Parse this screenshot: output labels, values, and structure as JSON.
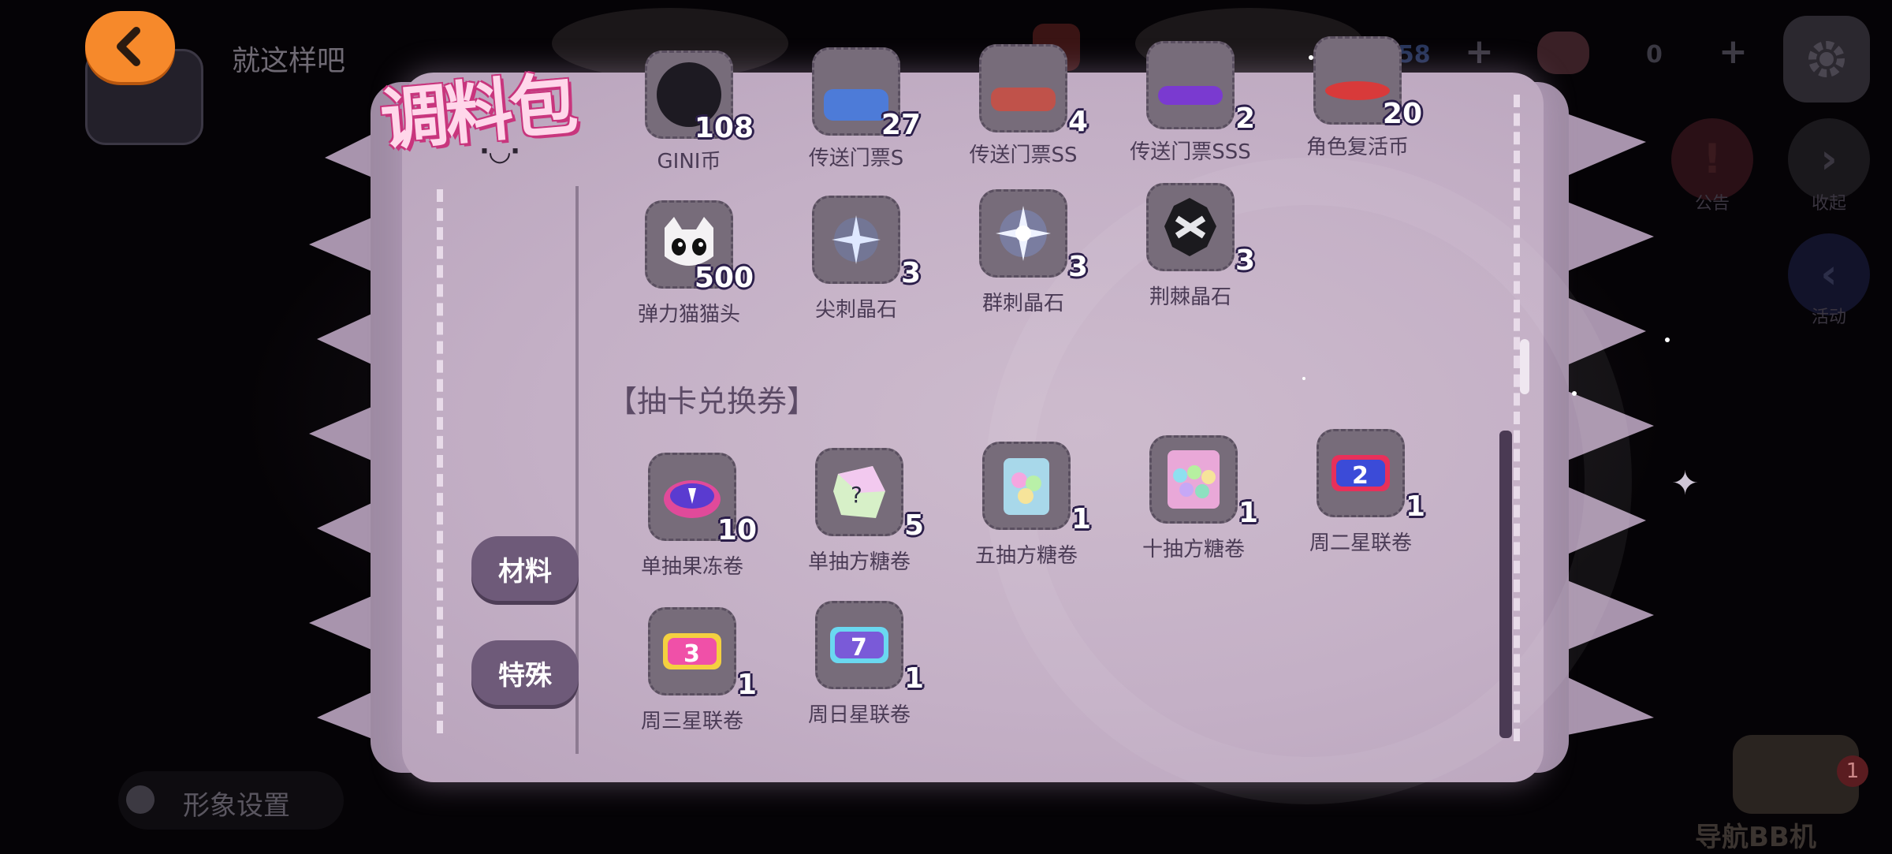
{
  "header": {
    "player_name": "就这样吧",
    "currency_1": "758",
    "currency_2": "0"
  },
  "side_buttons": {
    "notice": "公告",
    "collapse": "收起",
    "activity": "活动"
  },
  "bottom": {
    "profile_settings": "形象设置",
    "nav_bb": "导航BB机",
    "nav_badge": "1"
  },
  "panel": {
    "title": "调料包",
    "face": "·◡·",
    "tabs": {
      "material": "材料",
      "special": "特殊"
    },
    "section_gacha": "【抽卡兑换券】"
  },
  "items_row1": [
    {
      "name": "GINI币",
      "qty": "108",
      "icon": "gini-coin-icon"
    },
    {
      "name": "传送门票S",
      "qty": "27",
      "icon": "portal-ticket-s-icon"
    },
    {
      "name": "传送门票SS",
      "qty": "4",
      "icon": "portal-ticket-ss-icon"
    },
    {
      "name": "传送门票SSS",
      "qty": "2",
      "icon": "portal-ticket-sss-icon"
    },
    {
      "name": "角色复活币",
      "qty": "20",
      "icon": "revive-coin-icon"
    }
  ],
  "items_row2": [
    {
      "name": "弹力猫猫头",
      "qty": "500",
      "icon": "cat-head-icon"
    },
    {
      "name": "尖刺晶石",
      "qty": "3",
      "icon": "spike-crystal-icon"
    },
    {
      "name": "群刺晶石",
      "qty": "3",
      "icon": "cluster-crystal-icon"
    },
    {
      "name": "荆棘晶石",
      "qty": "3",
      "icon": "thorn-crystal-icon"
    }
  ],
  "items_row3": [
    {
      "name": "单抽果冻卷",
      "qty": "10",
      "icon": "jelly-roll-icon"
    },
    {
      "name": "单抽方糖卷",
      "qty": "5",
      "icon": "sugar-cube-icon"
    },
    {
      "name": "五抽方糖卷",
      "qty": "1",
      "icon": "five-sugar-pack-icon"
    },
    {
      "name": "十抽方糖卷",
      "qty": "1",
      "icon": "ten-sugar-pack-icon"
    },
    {
      "name": "周二星联卷",
      "qty": "1",
      "icon": "tuesday-ticket-icon"
    }
  ],
  "items_row4": [
    {
      "name": "周三星联卷",
      "qty": "1",
      "icon": "wednesday-ticket-icon"
    },
    {
      "name": "周日星联卷",
      "qty": "1",
      "icon": "sunday-ticket-icon"
    }
  ],
  "ticket_numbers": {
    "tuesday": "2",
    "wednesday": "3",
    "sunday": "7"
  },
  "colors": {
    "back_button": "#f6892b",
    "tab_bg": "#6e5a79",
    "panel_bg": "#c4b0c6",
    "qty_outline": "#2b1e4a",
    "title_pink": "#c8357d"
  }
}
